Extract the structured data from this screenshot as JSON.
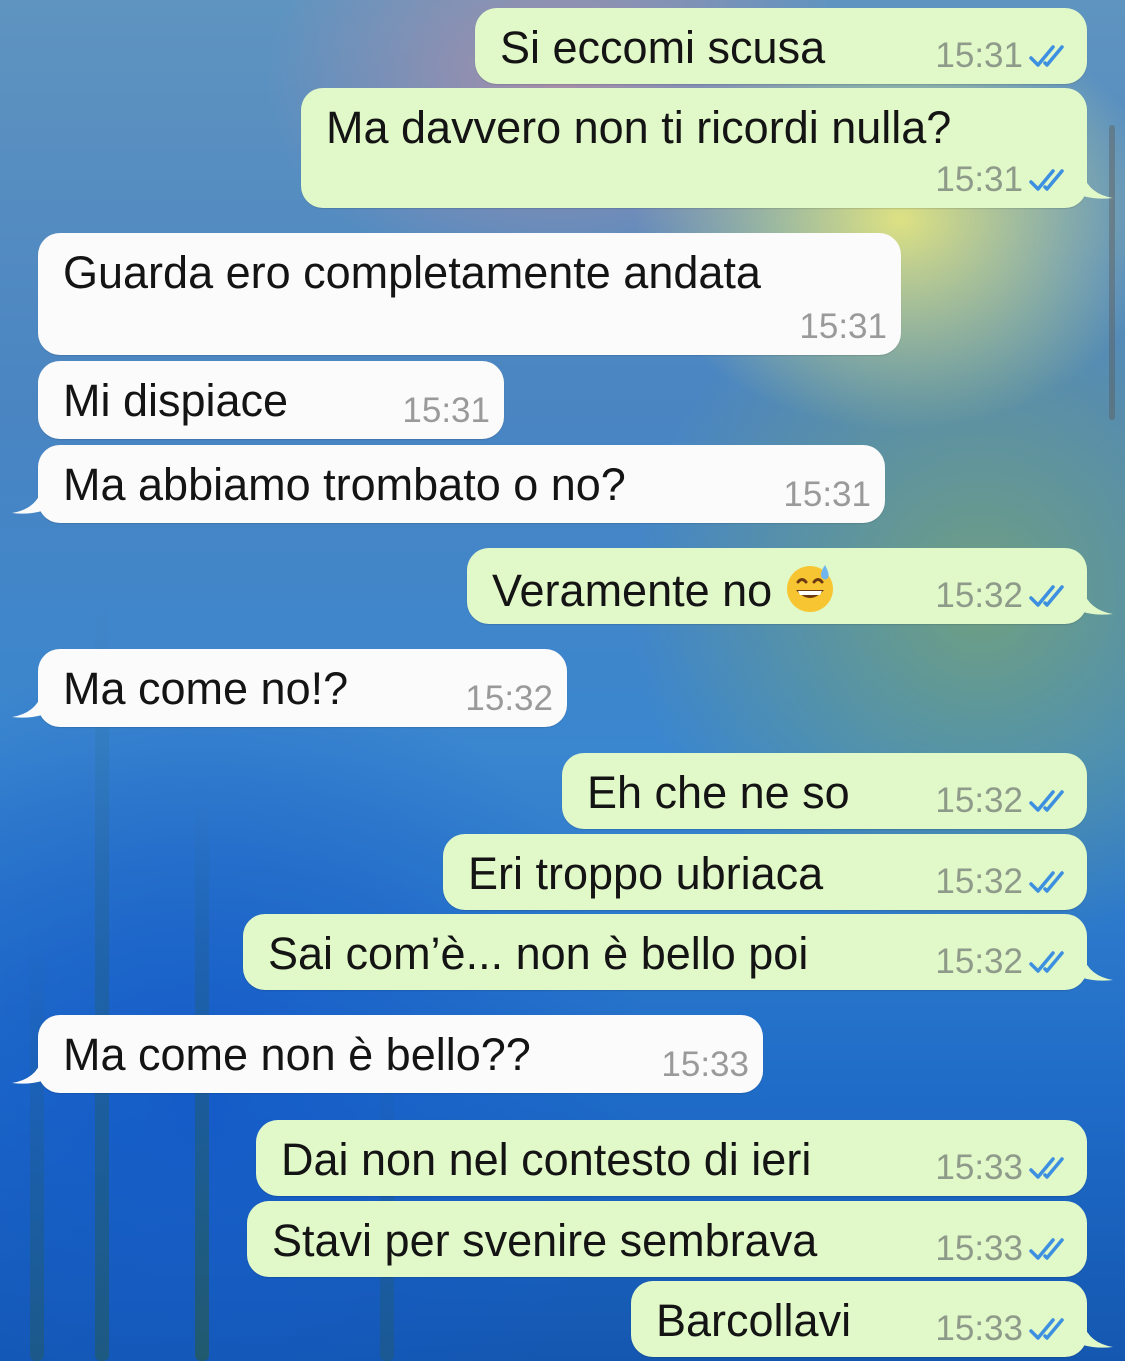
{
  "messages": [
    {
      "text": "Si eccomi scusa",
      "time": "15:31",
      "direction": "out"
    },
    {
      "text": "Ma davvero non ti ricordi nulla?",
      "time": "15:31",
      "direction": "out"
    },
    {
      "text": "Guarda ero completamente andata",
      "time": "15:31",
      "direction": "in"
    },
    {
      "text": "Mi dispiace",
      "time": "15:31",
      "direction": "in"
    },
    {
      "text": "Ma abbiamo trombato o no?",
      "time": "15:31",
      "direction": "in"
    },
    {
      "text": "Veramente no",
      "time": "15:32",
      "direction": "out",
      "emoji": "grinning-sweat-emoji"
    },
    {
      "text": "Ma come no!?",
      "time": "15:32",
      "direction": "in"
    },
    {
      "text": "Eh che ne so",
      "time": "15:32",
      "direction": "out"
    },
    {
      "text": "Eri troppo ubriaca",
      "time": "15:32",
      "direction": "out"
    },
    {
      "text": "Sai com’è... non è bello poi",
      "time": "15:32",
      "direction": "out"
    },
    {
      "text": "Ma come non è bello??",
      "time": "15:33",
      "direction": "in"
    },
    {
      "text": "Dai non nel contesto di ieri",
      "time": "15:33",
      "direction": "out"
    },
    {
      "text": "Stavi per svenire sembrava",
      "time": "15:33",
      "direction": "out"
    },
    {
      "text": "Barcollavi",
      "time": "15:33",
      "direction": "out"
    }
  ],
  "colors": {
    "outgoing_bubble": "#e1f8c8",
    "incoming_bubble": "#fbfbfb",
    "read_ticks": "#3d8fe0"
  },
  "icons": {
    "read_receipt": "double-check-icon"
  }
}
